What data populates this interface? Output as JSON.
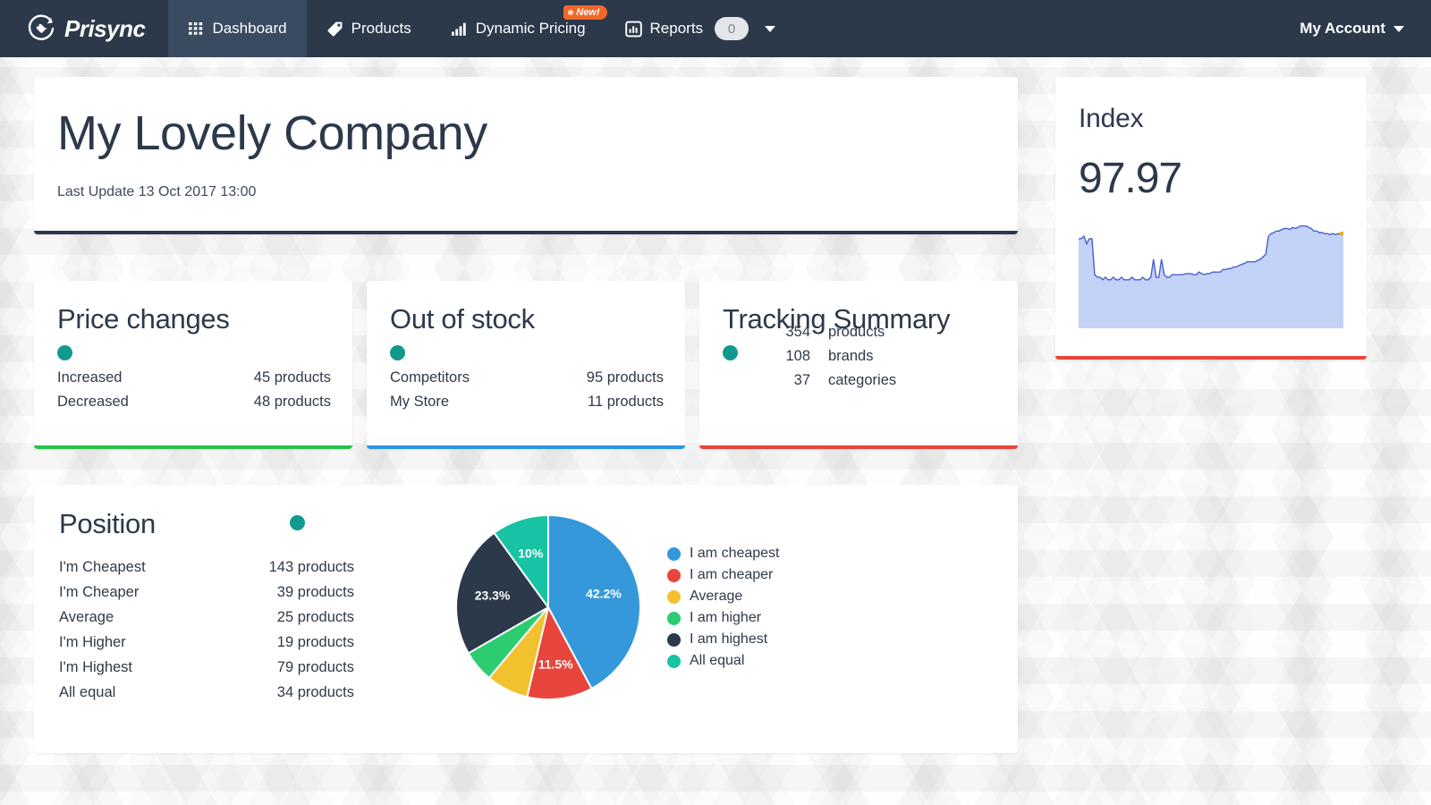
{
  "navbar": {
    "brand": "Prisync",
    "items": [
      {
        "label": "Dashboard",
        "icon": "grid-icon",
        "active": true
      },
      {
        "label": "Products",
        "icon": "tag-icon",
        "active": false
      },
      {
        "label": "Dynamic Pricing",
        "icon": "bar-chart-icon",
        "active": false,
        "badge": "New!"
      },
      {
        "label": "Reports",
        "icon": "report-chart-icon",
        "active": false,
        "count": "0"
      }
    ],
    "account_label": "My Account"
  },
  "header": {
    "company": "My Lovely Company",
    "last_update": "Last Update 13 Oct 2017 13:00",
    "accent": "#2c394b"
  },
  "price_changes": {
    "title": "Price changes",
    "accent": "#27c24c",
    "rows": [
      {
        "label": "Increased",
        "value": "45 products"
      },
      {
        "label": "Decreased",
        "value": "48 products"
      }
    ]
  },
  "out_of_stock": {
    "title": "Out of stock",
    "accent": "#2e95e2",
    "rows": [
      {
        "label": "Competitors",
        "value": "95 products"
      },
      {
        "label": "My Store",
        "value": "11 products"
      }
    ]
  },
  "tracking_summary": {
    "title": "Tracking Summary",
    "accent": "#e8453c",
    "rows": [
      {
        "num": "354",
        "unit": "products"
      },
      {
        "num": "108",
        "unit": "brands"
      },
      {
        "num": "37",
        "unit": "categories"
      }
    ]
  },
  "position": {
    "title": "Position",
    "rows": [
      {
        "label": "I'm Cheapest",
        "value": "143 products"
      },
      {
        "label": "I'm Cheaper",
        "value": "39 products"
      },
      {
        "label": "Average",
        "value": "25 products"
      },
      {
        "label": "I'm Higher",
        "value": "19 products"
      },
      {
        "label": "I'm Highest",
        "value": "79 products"
      },
      {
        "label": "All equal",
        "value": "34 products"
      }
    ]
  },
  "index": {
    "title": "Index",
    "value": "97.97",
    "accent": "#e8453c",
    "spark_fill": "#c3d2f7",
    "spark_line": "#4a5fd0",
    "spark_marker": "#f5a623"
  },
  "chart_data": {
    "type": "pie",
    "title": "Position",
    "labels": [
      "I am cheapest",
      "I am cheaper",
      "Average",
      "I am higher",
      "I am highest",
      "All equal"
    ],
    "values": [
      42.2,
      11.5,
      7.4,
      5.6,
      23.3,
      10.0
    ],
    "value_labels": [
      "42.2%",
      "11.5%",
      "",
      "",
      "23.3%",
      "10%"
    ],
    "counts": [
      143,
      39,
      25,
      19,
      79,
      34
    ],
    "colors": [
      "#3498db",
      "#e8453c",
      "#f2c12e",
      "#2ecc71",
      "#2c394b",
      "#17c3a2"
    ],
    "legend_position": "right",
    "grid": false
  },
  "index_chart": {
    "type": "area",
    "title": "Index",
    "ylim": [
      95,
      100
    ],
    "values": [
      98.3,
      98.3,
      98.35,
      98.2,
      98.3,
      98.3,
      97.6,
      97.55,
      97.55,
      97.5,
      97.55,
      97.5,
      97.5,
      97.55,
      97.5,
      97.5,
      97.55,
      97.5,
      97.5,
      97.5,
      97.55,
      97.5,
      97.5,
      97.5,
      97.55,
      97.5,
      97.5,
      97.55,
      97.9,
      97.55,
      97.55,
      97.9,
      97.6,
      97.55,
      97.55,
      97.6,
      97.6,
      97.6,
      97.6,
      97.6,
      97.62,
      97.62,
      97.62,
      97.6,
      97.6,
      97.65,
      97.62,
      97.6,
      97.62,
      97.62,
      97.65,
      97.65,
      97.65,
      97.65,
      97.7,
      97.7,
      97.72,
      97.72,
      97.75,
      97.75,
      97.78,
      97.8,
      97.82,
      97.85,
      97.85,
      97.85,
      97.85,
      97.88,
      97.9,
      97.95,
      98.0,
      98.35,
      98.4,
      98.42,
      98.45,
      98.45,
      98.48,
      98.5,
      98.5,
      98.48,
      98.52,
      98.5,
      98.52,
      98.55,
      98.55,
      98.55,
      98.52,
      98.5,
      98.45,
      98.45,
      98.42,
      98.42,
      98.4,
      98.4,
      98.38,
      98.4,
      98.38,
      98.4,
      98.38,
      98.4
    ]
  }
}
